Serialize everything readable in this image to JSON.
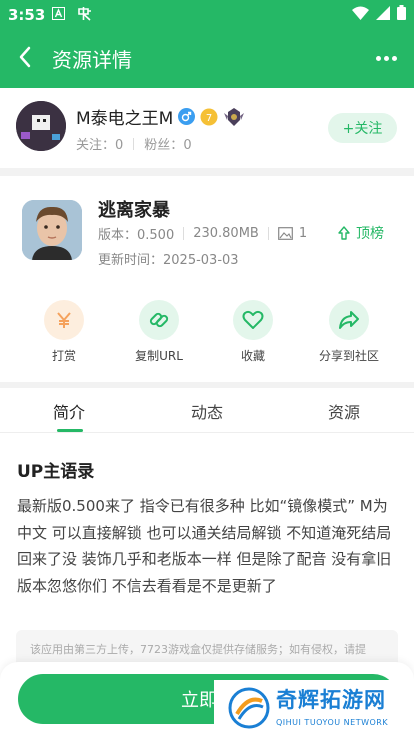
{
  "status_bar": {
    "time": "3:53"
  },
  "header": {
    "title": "资源详情"
  },
  "user": {
    "name": "M泰电之王M",
    "follow_label": "关注：",
    "follow_count": "0",
    "fans_label": "粉丝：",
    "fans_count": "0",
    "follow_button": "+关注"
  },
  "game": {
    "name": "逃离家暴",
    "version": "版本：0.500",
    "size": "230.80MB",
    "image_count": "1",
    "top_button": "顶榜",
    "update_date": "更新时间：2025-03-03"
  },
  "actions": [
    {
      "label": "打赏",
      "icon": "yen-icon"
    },
    {
      "label": "复制URL",
      "icon": "link-icon"
    },
    {
      "label": "收藏",
      "icon": "heart-icon"
    },
    {
      "label": "分享到社区",
      "icon": "share-icon"
    }
  ],
  "tabs": [
    "简介",
    "动态",
    "资源"
  ],
  "intro": {
    "title": "UP主语录",
    "text": "最新版0.500来了 指令已有很多种 比如“镜像模式” M为中文 可以直接解锁 也可以通关结局解锁 不知道淹死结局回来了没 装饰几乎和老版本一样 但是除了配音 没有拿旧版本忽悠你们 不信去看看是不是更新了",
    "notice": "该应用由第三方上传，7723游戏盒仅提供存储服务；如有侵权，请提"
  },
  "download_button": "立即下",
  "watermark": {
    "title": "奇辉拓游网",
    "subtitle": "QIHUI TUOYOU NETWORK"
  },
  "colors": {
    "accent": "#25b866",
    "watermark": "#1a7fd4"
  }
}
